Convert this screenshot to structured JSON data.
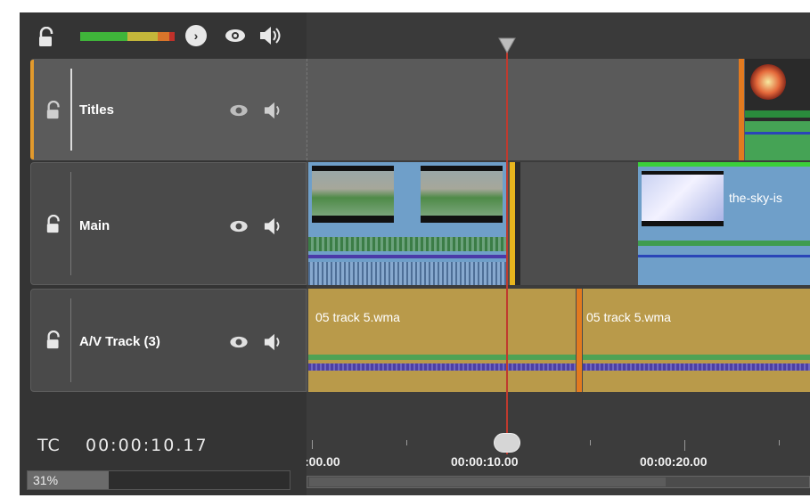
{
  "header": {
    "next_symbol": "›",
    "icons": [
      "lock-icon",
      "eye-icon",
      "speaker-icon",
      "next-icon"
    ]
  },
  "tracks": [
    {
      "name": "Titles",
      "selected": true
    },
    {
      "name": "Main",
      "selected": false
    },
    {
      "name": "A/V Track (3)",
      "selected": false
    }
  ],
  "timecode": {
    "label": "TC",
    "value": "00:00:10.17"
  },
  "progress": {
    "text": "31%",
    "value": 0.31
  },
  "timeline": {
    "ruler_labels": [
      ":00.00",
      "00:00:10.00",
      "00:00:20.00"
    ],
    "main_clip_label": "the-sky-is",
    "audio_clip_1_label": "05 track 5.wma",
    "audio_clip_2_label": "05 track 5.wma"
  },
  "colors": {
    "selection": "#e29a2d",
    "playhead": "#c03a2e",
    "audio_clip": "#b99a4a",
    "video_clip": "#6f9fc9",
    "meter_green": "#3fb43a"
  }
}
